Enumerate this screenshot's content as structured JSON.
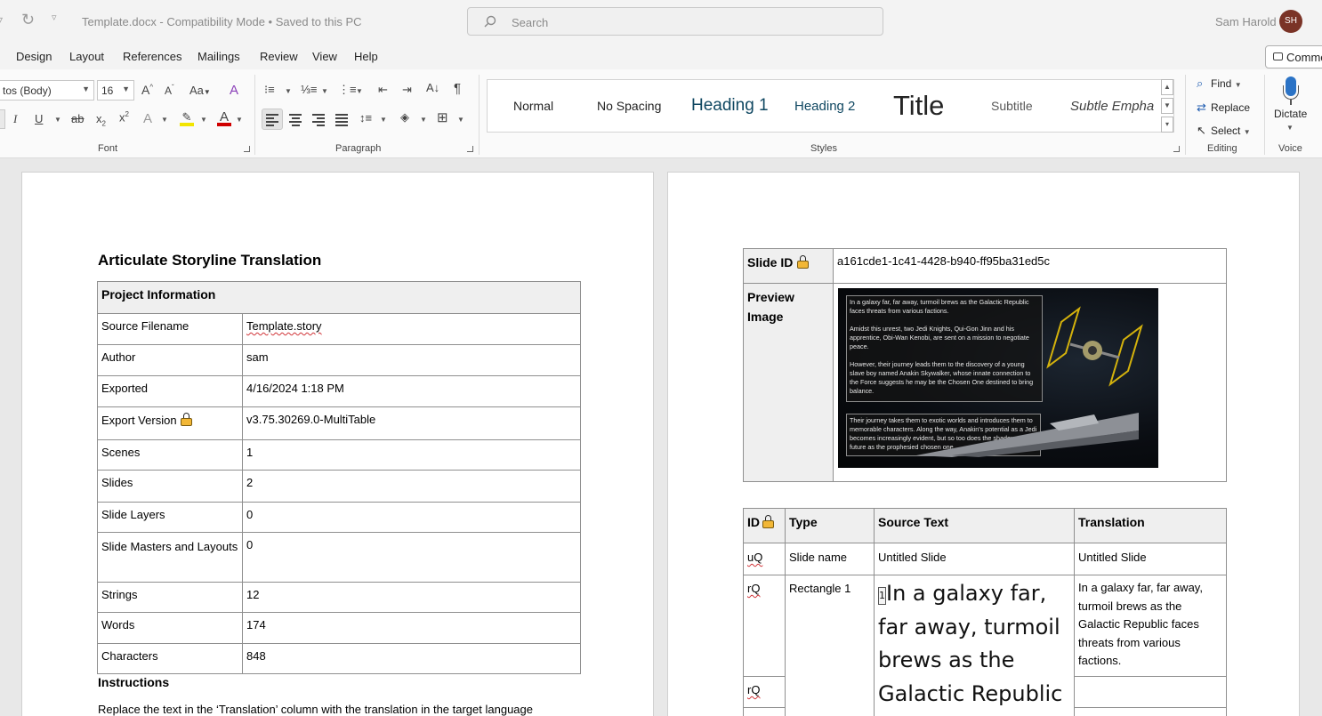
{
  "titlebar": {
    "doc_title": "Template.docx  -  Compatibility Mode  •  Saved to this PC",
    "search_placeholder": "Search",
    "user_name": "Sam Harold",
    "user_initials": "SH"
  },
  "menu": {
    "tabs": [
      "Design",
      "Layout",
      "References",
      "Mailings",
      "Review",
      "View",
      "Help"
    ],
    "comments_label": "Comme"
  },
  "ribbon": {
    "font_name": "tos (Body)",
    "font_size": "16",
    "groups": {
      "font": "Font",
      "paragraph": "Paragraph",
      "styles": "Styles",
      "editing": "Editing",
      "voice": "Voice"
    },
    "styles_gallery": [
      {
        "label": "Normal",
        "color": "#000000"
      },
      {
        "label": "No Spacing",
        "color": "#000000"
      },
      {
        "label": "Heading 1",
        "color": "#0f4761"
      },
      {
        "label": "Heading 2",
        "color": "#0f4761"
      },
      {
        "label": "Title",
        "color": "#000000"
      },
      {
        "label": "Subtitle",
        "color": "#595959"
      },
      {
        "label": "Subtle Empha",
        "color": "#404040"
      }
    ],
    "editing": {
      "find": "Find",
      "replace": "Replace",
      "select": "Select"
    },
    "dictate": "Dictate"
  },
  "doc_left": {
    "heading": "Articulate Storyline Translation",
    "project_info_header": "Project Information",
    "rows": [
      {
        "label": "Source Filename",
        "value": "Template.story"
      },
      {
        "label": "Author",
        "value": "sam"
      },
      {
        "label": "Exported",
        "value": "4/16/2024 1:18 PM"
      },
      {
        "label": "Export Version",
        "value": "v3.75.30269.0-MultiTable"
      },
      {
        "label": "Scenes",
        "value": "1"
      },
      {
        "label": "Slides",
        "value": "2"
      },
      {
        "label": "Slide Layers",
        "value": "0"
      },
      {
        "label": "Slide Masters and Layouts",
        "value": "0"
      },
      {
        "label": "Strings",
        "value": "12"
      },
      {
        "label": "Words",
        "value": "174"
      },
      {
        "label": "Characters",
        "value": "848"
      }
    ],
    "instructions_heading": "Instructions",
    "instructions_text": "Replace the text in the ‘Translation’ column with the translation in the target language"
  },
  "doc_right": {
    "slide_id_label": "Slide ID",
    "slide_id_value": "a161cde1-1c41-4428-b940-ff95ba31ed5c",
    "preview_label": "Preview Image",
    "preview_text": {
      "p1": "In a galaxy far, far away, turmoil brews as the Galactic Republic faces threats from various factions.",
      "p2": "Amidst this unrest, two Jedi Knights, Qui-Gon Jinn and his apprentice, Obi-Wan Kenobi, are sent on a mission to negotiate peace.",
      "p3": "However, their journey leads them to the discovery of a young slave boy named Anakin Skywalker, whose innate connection to the Force suggests he may be the Chosen One destined to bring balance.",
      "p4": "Their journey takes them to exotic worlds and introduces them to memorable characters. Along the way, Anakin's potential as a Jedi becomes increasingly evident, but so too does the shadow of his future as the prophesied chosen one."
    },
    "strings_headers": {
      "id": "ID",
      "type": "Type",
      "source": "Source Text",
      "translation": "Translation"
    },
    "row1": {
      "id": "uQ",
      "type": "Slide name",
      "source": "Untitled Slide",
      "translation": "Untitled Slide"
    },
    "row2": {
      "id": "rQ",
      "type": "Rectangle 1",
      "marker": "1",
      "source": "In a galaxy far, far away, turmoil brews as the Galactic Republic",
      "translation": "In a galaxy far, far away, turmoil brews as the Galactic Republic faces threats from various factions."
    },
    "row3": {
      "id": "rQ"
    }
  }
}
